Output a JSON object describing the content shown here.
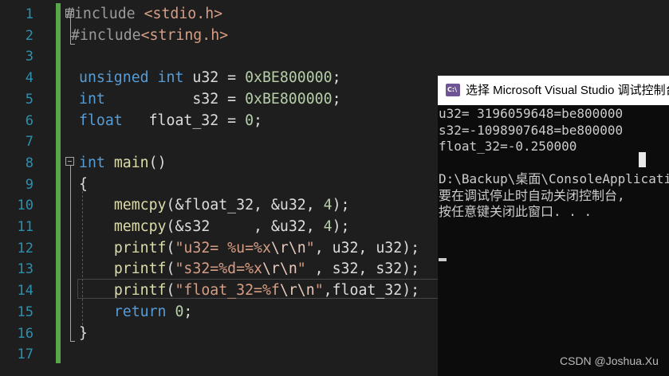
{
  "editor": {
    "line_numbers": [
      "1",
      "2",
      "3",
      "4",
      "5",
      "6",
      "7",
      "8",
      "9",
      "10",
      "11",
      "12",
      "13",
      "14",
      "15",
      "16",
      "17"
    ],
    "lines": [
      {
        "tokens": [
          {
            "t": "#include ",
            "c": "pp"
          },
          {
            "t": "<stdio.h>",
            "c": "str"
          }
        ]
      },
      {
        "tokens": [
          {
            "t": "#include",
            "c": "pp"
          },
          {
            "t": "<string.h>",
            "c": "str"
          }
        ]
      },
      {
        "tokens": []
      },
      {
        "tokens": [
          {
            "t": "unsigned ",
            "c": "kw"
          },
          {
            "t": "int ",
            "c": "kw"
          },
          {
            "t": "u32 = ",
            "c": "var"
          },
          {
            "t": "0xBE800000",
            "c": "num"
          },
          {
            "t": ";",
            "c": "var"
          }
        ]
      },
      {
        "tokens": [
          {
            "t": "int",
            "c": "kw"
          },
          {
            "t": "          s32 = ",
            "c": "var"
          },
          {
            "t": "0xBE800000",
            "c": "num"
          },
          {
            "t": ";",
            "c": "var"
          }
        ]
      },
      {
        "tokens": [
          {
            "t": "float",
            "c": "kw"
          },
          {
            "t": "   float_32 = ",
            "c": "var"
          },
          {
            "t": "0",
            "c": "num"
          },
          {
            "t": ";",
            "c": "var"
          }
        ]
      },
      {
        "tokens": []
      },
      {
        "tokens": [
          {
            "t": "int ",
            "c": "kw"
          },
          {
            "t": "main",
            "c": "fn"
          },
          {
            "t": "()",
            "c": "var"
          }
        ]
      },
      {
        "tokens": [
          {
            "t": "{",
            "c": "var"
          }
        ]
      },
      {
        "tokens": [
          {
            "t": "    ",
            "c": "var"
          },
          {
            "t": "memcpy",
            "c": "fn"
          },
          {
            "t": "(&float_32, &u32, ",
            "c": "var"
          },
          {
            "t": "4",
            "c": "num"
          },
          {
            "t": ");",
            "c": "var"
          }
        ]
      },
      {
        "tokens": [
          {
            "t": "    ",
            "c": "var"
          },
          {
            "t": "memcpy",
            "c": "fn"
          },
          {
            "t": "(&s32     , &u32, ",
            "c": "var"
          },
          {
            "t": "4",
            "c": "num"
          },
          {
            "t": ");",
            "c": "var"
          }
        ]
      },
      {
        "tokens": [
          {
            "t": "    ",
            "c": "var"
          },
          {
            "t": "printf",
            "c": "fn"
          },
          {
            "t": "(",
            "c": "var"
          },
          {
            "t": "\"u32= %u=%x",
            "c": "str"
          },
          {
            "t": "\\r\\n",
            "c": "esc"
          },
          {
            "t": "\"",
            "c": "str"
          },
          {
            "t": ", u32, u32);",
            "c": "var"
          }
        ]
      },
      {
        "tokens": [
          {
            "t": "    ",
            "c": "var"
          },
          {
            "t": "printf",
            "c": "fn"
          },
          {
            "t": "(",
            "c": "var"
          },
          {
            "t": "\"s32=%d=%x",
            "c": "str"
          },
          {
            "t": "\\r\\n",
            "c": "esc"
          },
          {
            "t": "\"",
            "c": "str"
          },
          {
            "t": " , s32, s32);",
            "c": "var"
          }
        ]
      },
      {
        "tokens": [
          {
            "t": "    ",
            "c": "var"
          },
          {
            "t": "printf",
            "c": "fn"
          },
          {
            "t": "(",
            "c": "var"
          },
          {
            "t": "\"float_32=%f",
            "c": "str"
          },
          {
            "t": "\\r\\n",
            "c": "esc"
          },
          {
            "t": "\"",
            "c": "str"
          },
          {
            "t": ",float_32);",
            "c": "var"
          }
        ]
      },
      {
        "tokens": [
          {
            "t": "    ",
            "c": "var"
          },
          {
            "t": "return ",
            "c": "kw"
          },
          {
            "t": "0",
            "c": "num"
          },
          {
            "t": ";",
            "c": "var"
          }
        ]
      },
      {
        "tokens": [
          {
            "t": "}",
            "c": "var"
          }
        ]
      },
      {
        "tokens": []
      }
    ]
  },
  "console": {
    "title": "选择 Microsoft Visual Studio 调试控制台",
    "icon_text": "C:\\",
    "lines": [
      "u32= 3196059648=be800000",
      "s32=-1098907648=be800000",
      "float_32=-0.250000",
      "",
      "D:\\Backup\\桌面\\ConsoleApplication",
      "要在调试停止时自动关闭控制台,",
      "按任意键关闭此窗口. . ."
    ]
  },
  "watermark": "CSDN @Joshua.Xu",
  "colors": {
    "background": "#1e1e1e",
    "line_number": "#2b91af",
    "keyword": "#569cd6",
    "string": "#d69d85",
    "function": "#dcdcaa",
    "number": "#b5cea8",
    "change_bar": "#57a64a",
    "console_bg": "#0c0c0c"
  }
}
